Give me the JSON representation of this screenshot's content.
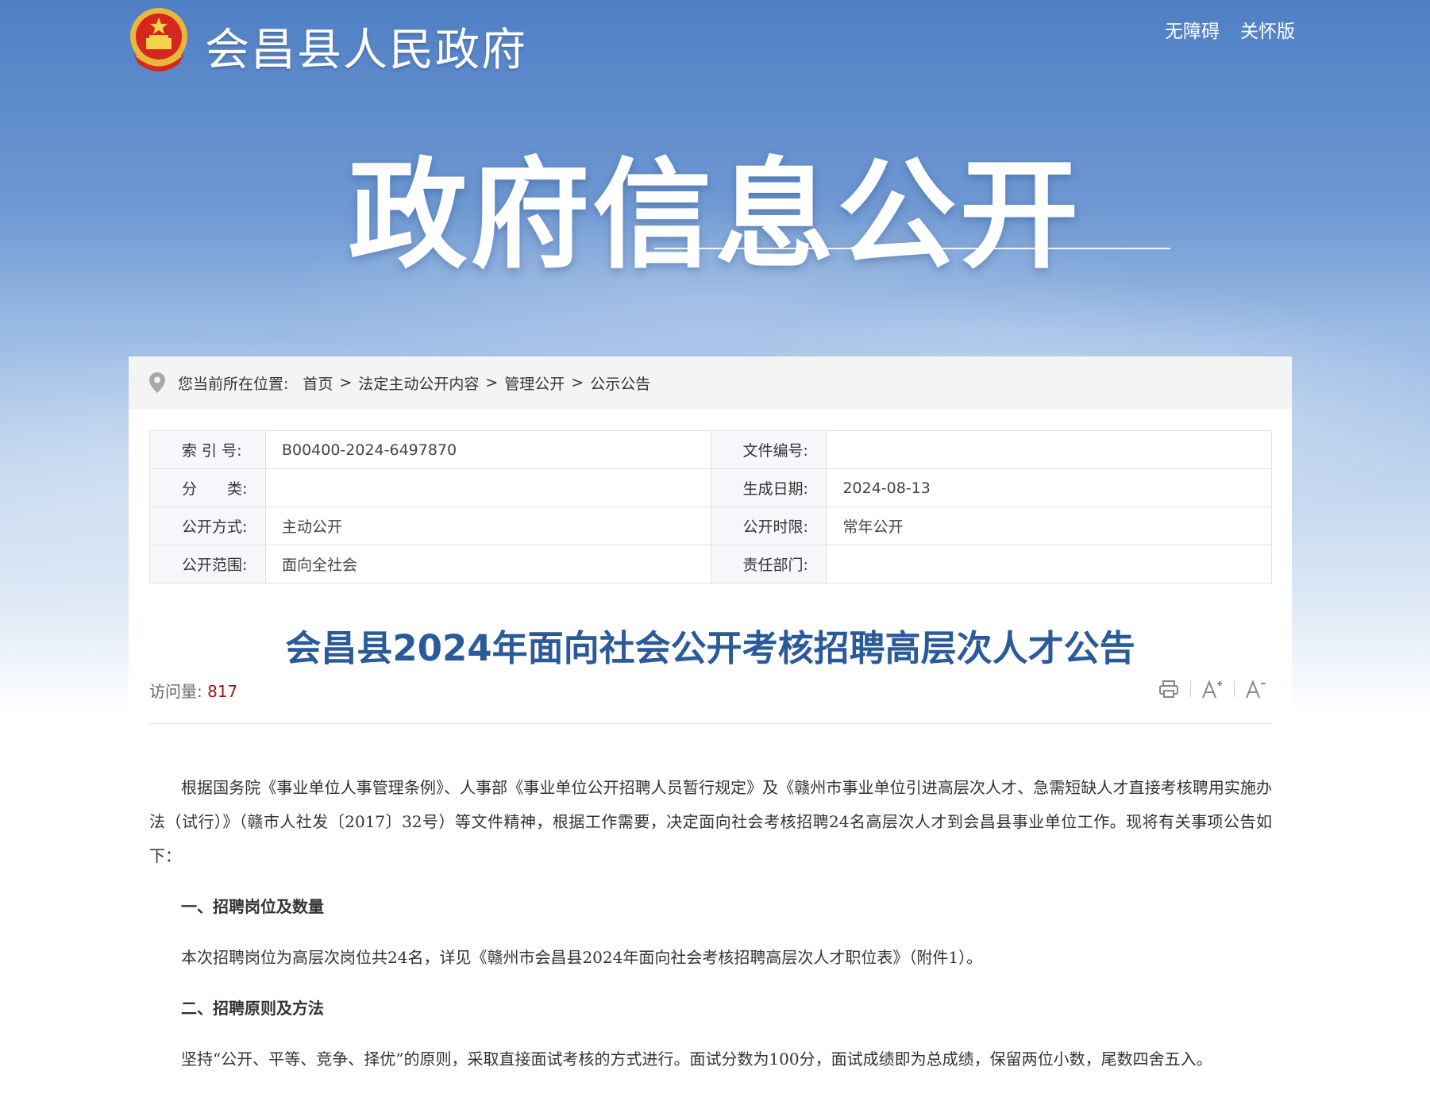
{
  "header": {
    "site_title": "会昌县人民政府",
    "links": [
      "无障碍",
      "关怀版"
    ]
  },
  "banner": {
    "title": "政府信息公开"
  },
  "breadcrumb": {
    "prefix": "您当前所在位置:",
    "items": [
      "首页",
      "法定主动公开内容",
      "管理公开",
      "公示公告"
    ],
    "separator": ">"
  },
  "meta": {
    "rows": [
      {
        "label1": "索 引 号:",
        "value1": "B00400-2024-6497870",
        "label2": "文件编号:",
        "value2": ""
      },
      {
        "label1": "分　　类:",
        "value1": "",
        "label2": "生成日期:",
        "value2": "2024-08-13"
      },
      {
        "label1": "公开方式:",
        "value1": "主动公开",
        "label2": "公开时限:",
        "value2": "常年公开"
      },
      {
        "label1": "公开范围:",
        "value1": "面向全社会",
        "label2": "责任部门:",
        "value2": ""
      }
    ]
  },
  "article": {
    "title": "会昌县2024年面向社会公开考核招聘高层次人才公告",
    "visits_label": "访问量:",
    "visits_count": "817",
    "paragraphs": [
      "根据国务院《事业单位人事管理条例》、人事部《事业单位公开招聘人员暂行规定》及《赣州市事业单位引进高层次人才、急需短缺人才直接考核聘用实施办法（试行）》（赣市人社发〔2017〕32号）等文件精神，根据工作需要，决定面向社会考核招聘24名高层次人才到会昌县事业单位工作。现将有关事项公告如下：",
      "一、招聘岗位及数量",
      "本次招聘岗位为高层次岗位共24名，详见《赣州市会昌县2024年面向社会考核招聘高层次人才职位表》（附件1）。",
      "二、招聘原则及方法",
      "坚持“公开、平等、竞争、择优”的原则，采取直接面试考核的方式进行。面试分数为100分，面试成绩即为总成绩，保留两位小数，尾数四舍五入。"
    ]
  },
  "icons": [
    "emblem-icon",
    "location-pin-icon",
    "print-icon",
    "font-increase-icon",
    "font-decrease-icon"
  ],
  "colors": {
    "title_blue": "#2a5a9a",
    "visits_red": "#a31515"
  }
}
